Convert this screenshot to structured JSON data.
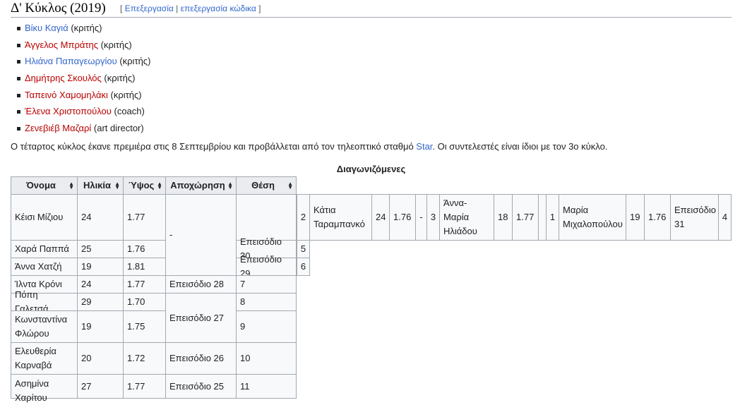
{
  "section": {
    "title": "Δ' Κύκλος (2019)",
    "edit_open": "[",
    "edit_label": "Επεξεργασία",
    "edit_sep": "|",
    "edit_code_label": "επεξεργασία κώδικα",
    "edit_close": "]"
  },
  "judges": [
    {
      "name": "Βίκυ Καγιά",
      "role": "(κριτής)"
    },
    {
      "name": "Άγγελος Μπράτης",
      "role": "(κριτής)"
    },
    {
      "name": "Ηλιάνα Παπαγεωργίου",
      "role": "(κριτής)"
    },
    {
      "name": "Δημήτρης Σκουλός",
      "role": "(κριτής)"
    },
    {
      "name": "Ταπεινό Χαμομηλάκι",
      "role": "(κριτής)"
    },
    {
      "name": "Έλενα Χριστοπούλου",
      "role": "(coach)"
    },
    {
      "name": "Ζενεβιέβ Μαζαρί",
      "role": "(art director)"
    }
  ],
  "intro": {
    "before": "Ο τέταρτος κύκλος έκανε πρεμιέρα στις 8 Σεπτεμβρίου και προβάλλεται από τον τηλεοπτικό σταθμό ",
    "link": "Star",
    "after": ". Οι συντελεστές είναι ίδιοι με τον 3ο κύκλο."
  },
  "table": {
    "caption": "Διαγωνιζόμενες",
    "headers": [
      "Όνομα",
      "Ηλικία",
      "Ύψος",
      "Αποχώρηση",
      "Θέση"
    ],
    "rows": [
      {
        "name": "Κέισι Μίζιου",
        "age": "24",
        "height": "1.77",
        "elim": "-",
        "place": ""
      },
      {
        "name": "Χαρά Παππά",
        "age": "25",
        "height": "1.76",
        "elim": "",
        "place": "Επεισόδιο 30",
        "rank": "5"
      },
      {
        "name": "Άννα Χατζή",
        "age": "19",
        "height": "1.81",
        "elim": "",
        "place": "Επεισόδιο 29",
        "rank": "6"
      },
      {
        "name": "Ίλντα Κρόνι",
        "age": "24",
        "height": "1.77",
        "elim": "Επεισόδιο 28",
        "place": "7"
      },
      {
        "name": "Πόπη Γαλετσά",
        "age": "29",
        "height": "1.70",
        "elim": "Επεισόδιο 27",
        "place": "8"
      },
      {
        "name": "Κωνσταντίνα Φλώρου",
        "age": "19",
        "height": "1.75",
        "elim": "",
        "place": "9"
      },
      {
        "name": "Ελευθερία Καρναβά",
        "age": "20",
        "height": "1.72",
        "elim": "Επεισόδιο 26",
        "place": "10"
      },
      {
        "name": "Ασημίνα Χαρίτου",
        "age": "27",
        "height": "1.77",
        "elim": "Επεισόδιο 25",
        "place": "11"
      }
    ],
    "overflow_row": {
      "rank_a": "2",
      "name_a": "Κάτια Ταραμπανκό",
      "age_a": "24",
      "height_a": "1.76",
      "dash": "-",
      "rank_b": "3",
      "name_b": "Άννα-Μαρία Ηλιάδου",
      "age_b": "18",
      "height_b": "1.77",
      "empty": "",
      "rank_c": "1",
      "name_c": "Μαρία Μιχαλοπούλου",
      "age_c": "19",
      "height_c": "1.76",
      "elim_c": "Επεισόδιο 31",
      "rank_d": "4"
    }
  },
  "icons": {
    "sort": "sort-arrows-icon"
  }
}
